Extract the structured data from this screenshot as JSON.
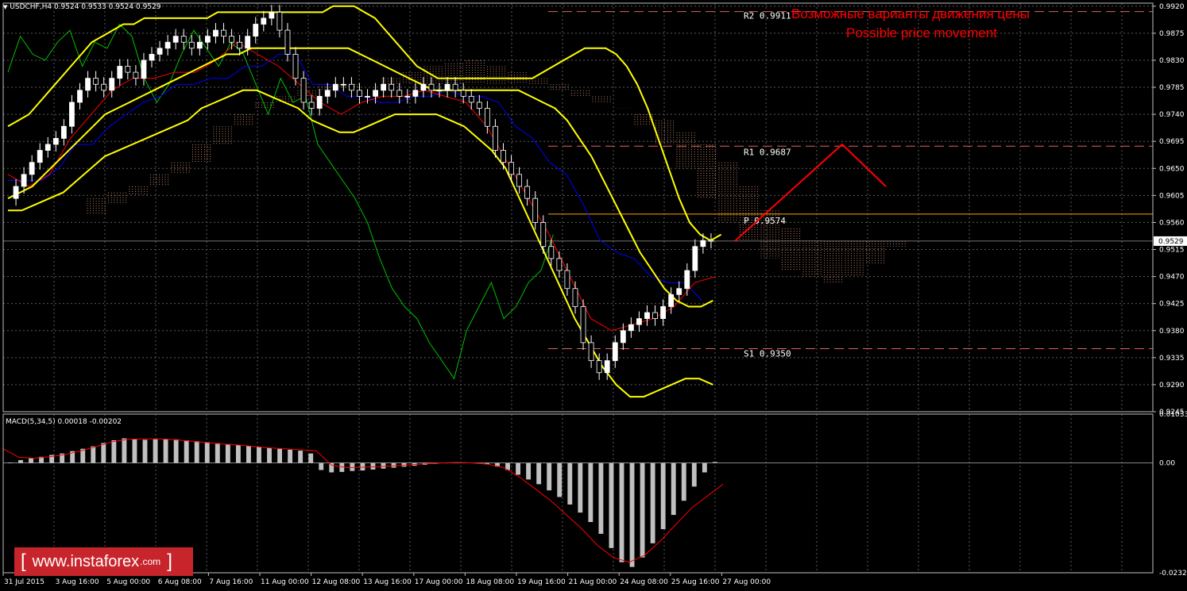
{
  "header": {
    "symbol_line": "USDCHF,H4  0.9524 0.9533 0.9524 0.9529"
  },
  "annotation": {
    "line1": "Возможные варианты движения цены",
    "line2": "Possible price movement",
    "color": "#ff0000"
  },
  "logo": {
    "bracket_left": "[",
    "text": "www.instaforex",
    "domain": ".com",
    "bracket_right": "]",
    "bg_color": "#c8242b"
  },
  "colors": {
    "bollinger": "#ffff00",
    "tenkan": "#ff0000",
    "kijun": "#0000ff",
    "chikou": "#00c000",
    "cloud": "#e8a080",
    "grid": "#5a5a5a",
    "bull_candle": "#ffffff",
    "bear_candle": "#000000",
    "macd_hist": "#c0c0c0",
    "macd_signal": "#ff0000",
    "projection": "#ff0000",
    "pivot": "#ffa500"
  },
  "chart_data": [
    {
      "type": "line",
      "title": "USDCHF,H4  0.9524 0.9533 0.9524 0.9529",
      "ylim": [
        0.9245,
        0.9925
      ],
      "y_ticks": [
        "0.9920",
        "0.9875",
        "0.9830",
        "0.9785",
        "0.9740",
        "0.9695",
        "0.9650",
        "0.9605",
        "0.9560",
        "0.9515",
        "0.9470",
        "0.9425",
        "0.9380",
        "0.9335",
        "0.9290",
        "0.9245"
      ],
      "current_price": "0.9529",
      "x_ticks": [
        "31 Jul 2015",
        "3 Aug 16:00",
        "5 Aug 00:00",
        "6 Aug 08:00",
        "7 Aug 16:00",
        "11 Aug 00:00",
        "12 Aug 08:00",
        "13 Aug 16:00",
        "17 Aug 00:00",
        "18 Aug 08:00",
        "19 Aug 16:00",
        "21 Aug 00:00",
        "24 Aug 08:00",
        "25 Aug 16:00",
        "27 Aug 00:00"
      ],
      "levels": [
        {
          "label": "R2  0.9911",
          "value": 0.9911
        },
        {
          "label": "R1  0.9687",
          "value": 0.9687
        },
        {
          "label": "P  0.9574",
          "value": 0.9574
        },
        {
          "label": "S1  0.9350",
          "value": 0.935
        }
      ],
      "close_series": [
        0.96,
        0.962,
        0.964,
        0.966,
        0.968,
        0.969,
        0.97,
        0.972,
        0.976,
        0.978,
        0.98,
        0.979,
        0.978,
        0.98,
        0.982,
        0.981,
        0.98,
        0.983,
        0.984,
        0.985,
        0.986,
        0.987,
        0.986,
        0.985,
        0.986,
        0.987,
        0.988,
        0.987,
        0.986,
        0.985,
        0.987,
        0.989,
        0.99,
        0.991,
        0.988,
        0.984,
        0.98,
        0.976,
        0.975,
        0.977,
        0.978,
        0.979,
        0.979,
        0.978,
        0.977,
        0.977,
        0.978,
        0.979,
        0.978,
        0.977,
        0.977,
        0.978,
        0.979,
        0.978,
        0.978,
        0.979,
        0.978,
        0.977,
        0.976,
        0.975,
        0.972,
        0.968,
        0.966,
        0.964,
        0.962,
        0.96,
        0.956,
        0.952,
        0.95,
        0.948,
        0.945,
        0.942,
        0.936,
        0.933,
        0.931,
        0.933,
        0.936,
        0.938,
        0.939,
        0.94,
        0.941,
        0.94,
        0.942,
        0.944,
        0.945,
        0.948,
        0.952,
        0.953,
        0.9529
      ],
      "bollinger_upper": [
        0.972,
        0.973,
        0.974,
        0.976,
        0.978,
        0.98,
        0.982,
        0.984,
        0.986,
        0.987,
        0.988,
        0.989,
        0.989,
        0.99,
        0.99,
        0.99,
        0.99,
        0.99,
        0.99,
        0.99,
        0.991,
        0.991,
        0.991,
        0.991,
        0.991,
        0.991,
        0.991,
        0.991,
        0.991,
        0.991,
        0.991,
        0.992,
        0.992,
        0.992,
        0.991,
        0.99,
        0.988,
        0.986,
        0.984,
        0.982,
        0.981,
        0.98,
        0.98,
        0.98,
        0.98,
        0.98,
        0.98,
        0.98,
        0.98,
        0.98,
        0.98,
        0.981,
        0.982,
        0.983,
        0.984,
        0.985,
        0.985,
        0.985,
        0.984,
        0.982,
        0.979,
        0.975,
        0.97,
        0.965,
        0.96,
        0.956,
        0.954,
        0.953,
        0.954
      ],
      "bollinger_mid": [
        0.96,
        0.961,
        0.962,
        0.964,
        0.966,
        0.968,
        0.97,
        0.972,
        0.974,
        0.975,
        0.976,
        0.977,
        0.978,
        0.979,
        0.98,
        0.981,
        0.982,
        0.983,
        0.984,
        0.984,
        0.985,
        0.985,
        0.985,
        0.985,
        0.985,
        0.985,
        0.985,
        0.985,
        0.985,
        0.984,
        0.983,
        0.982,
        0.981,
        0.98,
        0.979,
        0.978,
        0.978,
        0.978,
        0.978,
        0.978,
        0.978,
        0.978,
        0.978,
        0.977,
        0.976,
        0.975,
        0.973,
        0.97,
        0.967,
        0.963,
        0.959,
        0.955,
        0.951,
        0.948,
        0.945,
        0.943,
        0.942,
        0.942,
        0.943
      ],
      "bollinger_lower": [
        0.958,
        0.958,
        0.959,
        0.96,
        0.961,
        0.963,
        0.965,
        0.967,
        0.968,
        0.969,
        0.97,
        0.971,
        0.972,
        0.973,
        0.975,
        0.976,
        0.977,
        0.978,
        0.978,
        0.977,
        0.976,
        0.975,
        0.973,
        0.972,
        0.971,
        0.971,
        0.972,
        0.973,
        0.974,
        0.974,
        0.974,
        0.974,
        0.973,
        0.972,
        0.97,
        0.968,
        0.965,
        0.96,
        0.955,
        0.95,
        0.945,
        0.94,
        0.936,
        0.932,
        0.929,
        0.927,
        0.927,
        0.928,
        0.929,
        0.93,
        0.93,
        0.929
      ],
      "macd": {
        "label": "MACD(5,34,5) 0.00018 -0.00202",
        "ylim": [
          -0.02323,
          0.01033
        ],
        "y_ticks": [
          "0.01033",
          "0.00",
          "-0.02323"
        ],
        "histogram": [
          0.0001,
          0.0006,
          0.001,
          0.0013,
          0.0017,
          0.002,
          0.0025,
          0.003,
          0.0035,
          0.0042,
          0.0048,
          0.0052,
          0.005,
          0.0049,
          0.005,
          0.0051,
          0.005,
          0.0048,
          0.0046,
          0.0044,
          0.0042,
          0.004,
          0.0038,
          0.0036,
          0.0034,
          0.0032,
          0.003,
          0.0028,
          0.0026,
          0.002,
          -0.0015,
          -0.002,
          -0.0019,
          -0.0017,
          -0.0016,
          -0.0014,
          -0.0012,
          -0.001,
          -0.0008,
          -0.0006,
          -0.0004,
          -0.0002,
          0.0,
          0.0001,
          0.0001,
          0.0,
          -0.0003,
          -0.0008,
          -0.0015,
          -0.0025,
          -0.0035,
          -0.0045,
          -0.0058,
          -0.0072,
          -0.0088,
          -0.0105,
          -0.0125,
          -0.015,
          -0.018,
          -0.021,
          -0.022,
          -0.02,
          -0.017,
          -0.014,
          -0.011,
          -0.008,
          -0.005,
          -0.002,
          0.0002
        ],
        "signal": [
          0.003,
          0.0012,
          0.001,
          0.0013,
          0.0018,
          0.0026,
          0.0035,
          0.0045,
          0.005,
          0.0051,
          0.0051,
          0.0049,
          0.0046,
          0.0043,
          0.004,
          0.0038,
          0.0035,
          0.0032,
          0.003,
          0.0028,
          0.0026,
          -0.0005,
          -0.001,
          -0.0009,
          -0.0008,
          -0.0006,
          -0.0004,
          -0.0002,
          0.0,
          0.0001,
          0.0,
          -0.0003,
          -0.001,
          -0.003,
          -0.0055,
          -0.008,
          -0.011,
          -0.014,
          -0.0175,
          -0.02,
          -0.021,
          -0.0195,
          -0.0165,
          -0.013,
          -0.0095,
          -0.007,
          -0.0045
        ]
      }
    }
  ]
}
